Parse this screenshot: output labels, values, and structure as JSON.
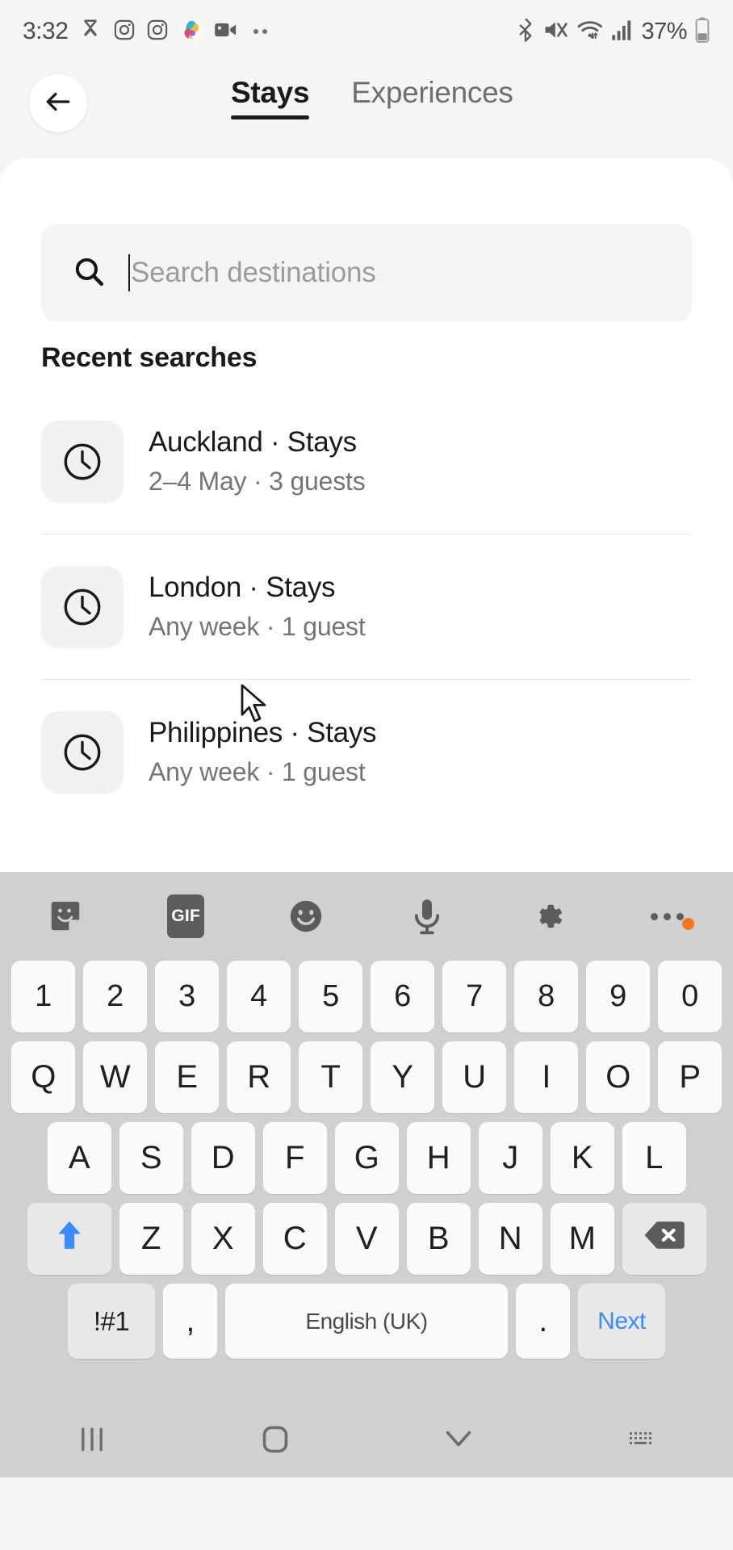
{
  "status_bar": {
    "time": "3:32",
    "battery_percent": "37%",
    "left_icons": [
      "hourglass-icon",
      "instagram-icon",
      "instagram-icon",
      "copilot-icon",
      "video-camera-icon",
      "more-notifications-icon"
    ],
    "right_icons": [
      "bluetooth-icon",
      "mute-icon",
      "wifi-icon",
      "cellular-signal-icon",
      "battery-icon"
    ]
  },
  "header": {
    "back_label": "back-arrow",
    "tabs": [
      {
        "label": "Stays",
        "active": true
      },
      {
        "label": "Experiences",
        "active": false
      }
    ]
  },
  "search": {
    "placeholder": "Search destinations",
    "value": "",
    "icon": "search-icon"
  },
  "recent": {
    "title": "Recent searches",
    "items": [
      {
        "icon": "clock-icon",
        "title": "Auckland · Stays",
        "subtitle": "2–4 May · 3 guests"
      },
      {
        "icon": "clock-icon",
        "title": "London · Stays",
        "subtitle": "Any week · 1 guest"
      },
      {
        "icon": "clock-icon",
        "title": "Philippines · Stays",
        "subtitle": "Any week · 1 guest"
      }
    ]
  },
  "keyboard": {
    "toolbar": [
      {
        "name": "sticker-icon",
        "label": ""
      },
      {
        "name": "gif-icon",
        "label": "GIF"
      },
      {
        "name": "emoji-icon",
        "label": ""
      },
      {
        "name": "microphone-icon",
        "label": ""
      },
      {
        "name": "settings-gear-icon",
        "label": ""
      },
      {
        "name": "overflow-menu-icon",
        "label": ""
      }
    ],
    "row_numbers": [
      "1",
      "2",
      "3",
      "4",
      "5",
      "6",
      "7",
      "8",
      "9",
      "0"
    ],
    "row_top": [
      "Q",
      "W",
      "E",
      "R",
      "T",
      "Y",
      "U",
      "I",
      "O",
      "P"
    ],
    "row_home": [
      "A",
      "S",
      "D",
      "F",
      "G",
      "H",
      "J",
      "K",
      "L"
    ],
    "row_bottom": [
      "Z",
      "X",
      "C",
      "V",
      "B",
      "N",
      "M"
    ],
    "shift_label": "shift-arrow",
    "backspace_label": "backspace",
    "bottom_row": {
      "symbols": "!#1",
      "comma": ",",
      "space": "English (UK)",
      "period": ".",
      "action": "Next"
    }
  },
  "nav_bar": {
    "items": [
      "recents-icon",
      "home-icon",
      "back-chevron-icon",
      "hide-keyboard-icon"
    ]
  },
  "colors": {
    "accent_blue": "#3e8bff",
    "shift_blue": "#3e8bff",
    "orange_badge": "#f4771e",
    "keyboard_bg": "#d0d0d0",
    "sheet_bg": "#ffffff",
    "page_bg": "#f5f5f5"
  }
}
